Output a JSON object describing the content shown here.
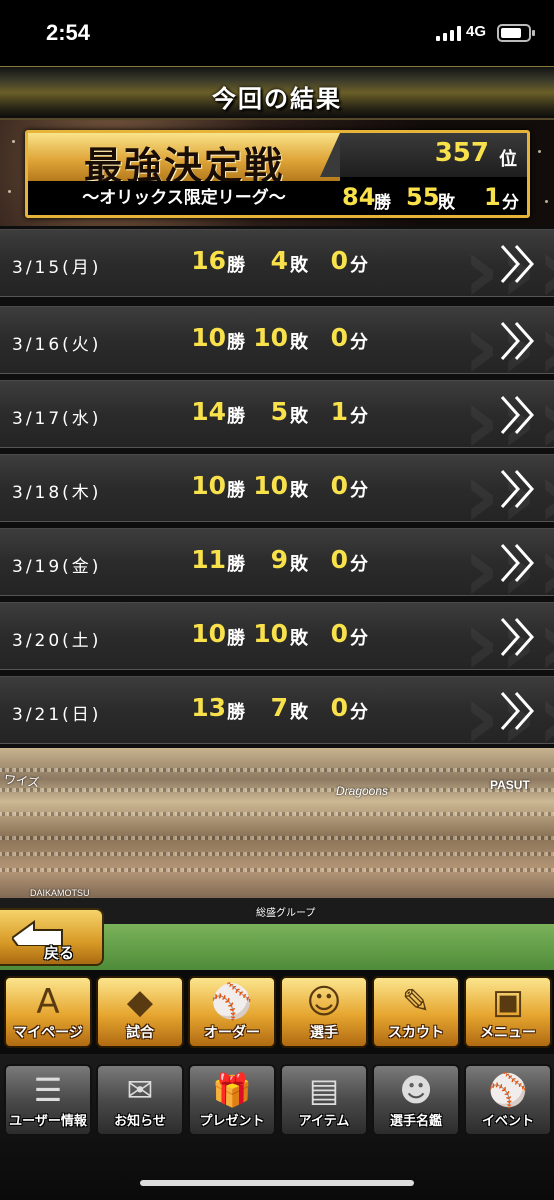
{
  "status_bar": {
    "time": "2:54",
    "network": "4G"
  },
  "header": {
    "title": "今回の結果"
  },
  "summary": {
    "event_title": "最強決定戦",
    "league": "〜オリックス限定リーグ〜",
    "rank_value": "357",
    "rank_unit": "位",
    "wins": "84",
    "wins_unit": "勝",
    "losses": "55",
    "losses_unit": "敗",
    "draws": "1",
    "draws_unit": "分"
  },
  "results": [
    {
      "date": "3/15(月)",
      "wins": "16",
      "losses": "4",
      "draws": "0"
    },
    {
      "date": "3/16(火)",
      "wins": "10",
      "losses": "10",
      "draws": "0"
    },
    {
      "date": "3/17(水)",
      "wins": "14",
      "losses": "5",
      "draws": "1"
    },
    {
      "date": "3/18(木)",
      "wins": "10",
      "losses": "10",
      "draws": "0"
    },
    {
      "date": "3/19(金)",
      "wins": "11",
      "losses": "9",
      "draws": "0"
    },
    {
      "date": "3/20(土)",
      "wins": "10",
      "losses": "10",
      "draws": "0"
    },
    {
      "date": "3/21(日)",
      "wins": "13",
      "losses": "7",
      "draws": "0"
    }
  ],
  "units": {
    "win": "勝",
    "loss": "敗",
    "draw": "分"
  },
  "stadium": {
    "signs": [
      "ワイズ",
      "Dragoons",
      "PASUT",
      "DAIKAMOTSU",
      "総盛グループ"
    ]
  },
  "back_button": {
    "label": "戻る"
  },
  "nav_primary": [
    {
      "label": "マイページ",
      "icon": "A"
    },
    {
      "label": "試合",
      "icon": "◆"
    },
    {
      "label": "オーダー",
      "icon": "⚾"
    },
    {
      "label": "選手",
      "icon": "☺"
    },
    {
      "label": "スカウト",
      "icon": "✎"
    },
    {
      "label": "メニュー",
      "icon": "▣"
    }
  ],
  "nav_secondary": [
    {
      "label": "ユーザー情報",
      "icon": "☰"
    },
    {
      "label": "お知らせ",
      "icon": "✉"
    },
    {
      "label": "プレゼント",
      "icon": "🎁"
    },
    {
      "label": "アイテム",
      "icon": "▤"
    },
    {
      "label": "選手名鑑",
      "icon": "☻"
    },
    {
      "label": "イベント",
      "icon": "⚾"
    }
  ],
  "colors": {
    "accent_yellow": "#f8e14a",
    "gold": "#e6a52f"
  }
}
